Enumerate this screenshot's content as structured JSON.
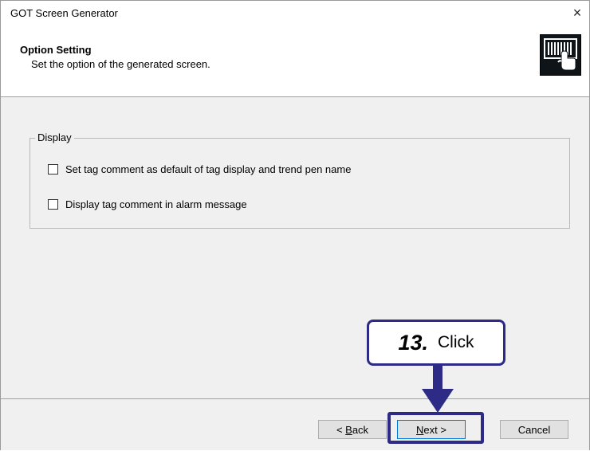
{
  "window": {
    "title": "GOT Screen Generator",
    "close_label": "×"
  },
  "header": {
    "title": "Option Setting",
    "subtitle": "Set the option of the generated screen.",
    "icon": "touch-panel-icon"
  },
  "display_group": {
    "label": "Display",
    "options": [
      {
        "label": "Set tag comment as default of tag display and trend pen name",
        "checked": false
      },
      {
        "label": "Display tag comment in alarm message",
        "checked": false
      }
    ]
  },
  "buttons": {
    "back_prefix": "< ",
    "back_underlined": "B",
    "back_rest": "ack",
    "next_underlined": "N",
    "next_rest": "ext >",
    "cancel": "Cancel"
  },
  "callout": {
    "step": "13.",
    "action": "Click"
  },
  "colors": {
    "annotation": "#2e2b86",
    "dialog_bg": "#f0f0f0",
    "header_bg": "#ffffff"
  }
}
